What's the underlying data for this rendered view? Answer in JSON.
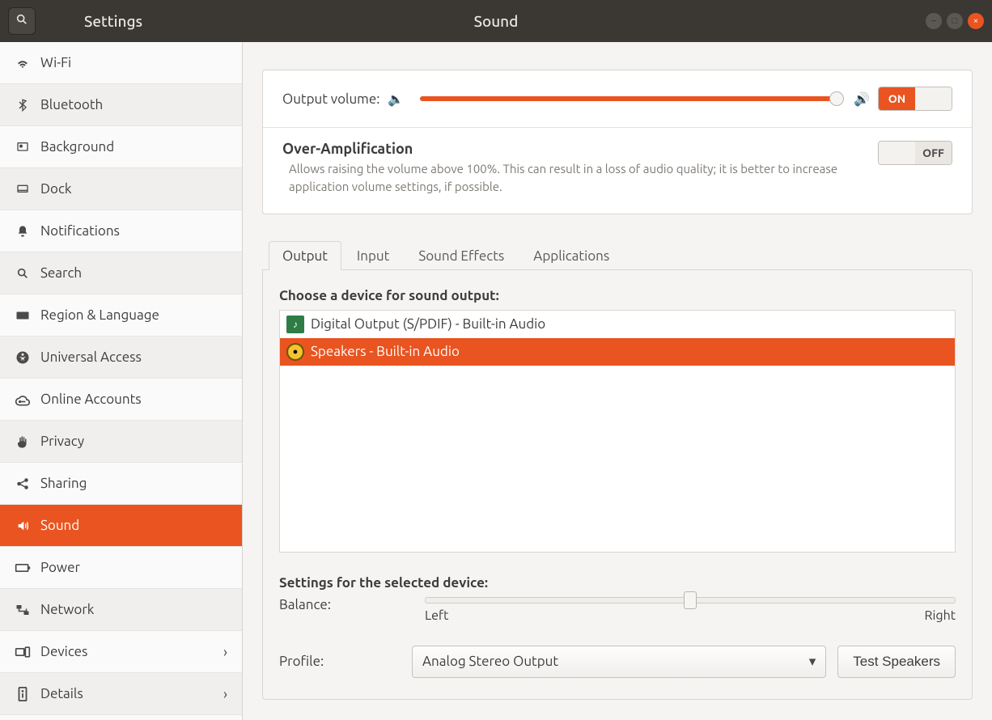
{
  "titlebar": {
    "app_title": "Settings",
    "page_title": "Sound"
  },
  "sidebar": {
    "items": [
      {
        "label": "Wi-Fi"
      },
      {
        "label": "Bluetooth"
      },
      {
        "label": "Background"
      },
      {
        "label": "Dock"
      },
      {
        "label": "Notifications"
      },
      {
        "label": "Search"
      },
      {
        "label": "Region & Language"
      },
      {
        "label": "Universal Access"
      },
      {
        "label": "Online Accounts"
      },
      {
        "label": "Privacy"
      },
      {
        "label": "Sharing"
      },
      {
        "label": "Sound"
      },
      {
        "label": "Power"
      },
      {
        "label": "Network"
      },
      {
        "label": "Devices"
      },
      {
        "label": "Details"
      }
    ],
    "active_index": 11
  },
  "volume": {
    "label": "Output volume:",
    "percent": 100,
    "toggle_on_label": "ON",
    "toggle_state": "on"
  },
  "overamp": {
    "title": "Over-Amplification",
    "desc": "Allows raising the volume above 100%. This can result in a loss of audio quality; it is better to increase application volume settings, if possible.",
    "toggle_off_label": "OFF",
    "toggle_state": "off"
  },
  "tabs": {
    "items": [
      "Output",
      "Input",
      "Sound Effects",
      "Applications"
    ],
    "active_index": 0
  },
  "output": {
    "choose_label": "Choose a device for sound output:",
    "devices": [
      {
        "label": "Digital Output (S/PDIF) - Built-in Audio"
      },
      {
        "label": "Speakers - Built-in Audio"
      }
    ],
    "selected_index": 1,
    "settings_label": "Settings for the selected device:",
    "balance_label": "Balance:",
    "balance_left": "Left",
    "balance_right": "Right",
    "balance_value": 50,
    "profile_label": "Profile:",
    "profile_value": "Analog Stereo Output",
    "test_button": "Test Speakers"
  },
  "colors": {
    "accent": "#e95420"
  }
}
